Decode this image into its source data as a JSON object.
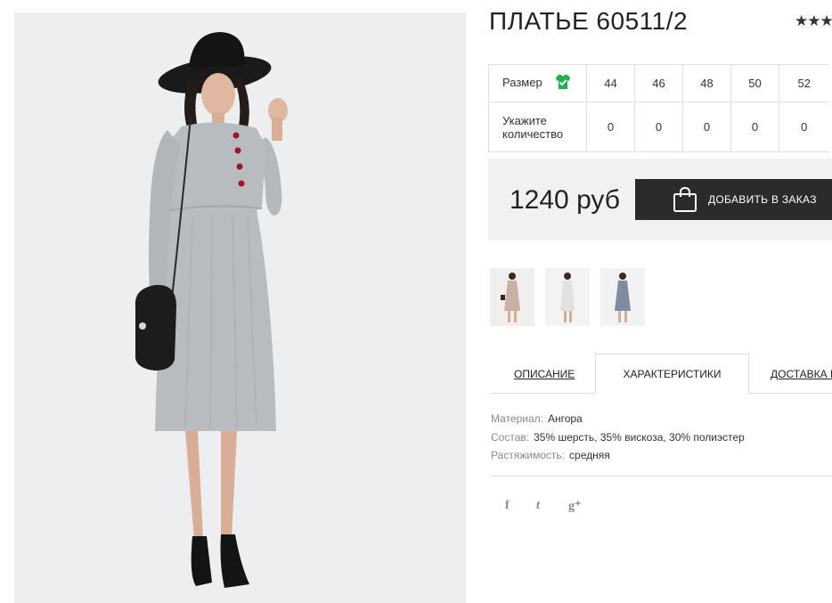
{
  "product": {
    "title": "ПЛАТЬЕ 60511/2",
    "rating_stars": "★★★"
  },
  "sizes": {
    "size_label": "Размер",
    "qty_label": "Укажите количество",
    "values": [
      "44",
      "46",
      "48",
      "50",
      "52"
    ],
    "quantities": [
      "0",
      "0",
      "0",
      "0",
      "0"
    ],
    "badge_color": "#1db34a"
  },
  "price": {
    "value": "1240 руб",
    "button_label": "ДОБАВИТЬ В ЗАКАЗ"
  },
  "thumbnails": [
    {
      "name": "pink-dress-thumb",
      "color": "#c9b1a7"
    },
    {
      "name": "white-dress-thumb",
      "color": "#e6e6e4"
    },
    {
      "name": "blue-dress-thumb",
      "color": "#7f8aa3"
    }
  ],
  "tabs": {
    "description": "ОПИСАНИЕ",
    "characteristics": "ХАРАКТЕРИСТИКИ",
    "delivery": "ДОСТАВКА И"
  },
  "specs": [
    {
      "key": "Материал:",
      "value": "Ангора"
    },
    {
      "key": "Состав:",
      "value": "35% шерсть, 35% вискоза, 30% полиэстер"
    },
    {
      "key": "Растяжимость:",
      "value": "средняя"
    }
  ],
  "social": {
    "facebook": "f",
    "twitter": "t",
    "google": "g⁺"
  },
  "colors": {
    "dress": "#b9bcbe",
    "button_bg": "#2b2b2b",
    "button_text": "#ffffff",
    "buttons_on_dress": "#a0142a"
  }
}
